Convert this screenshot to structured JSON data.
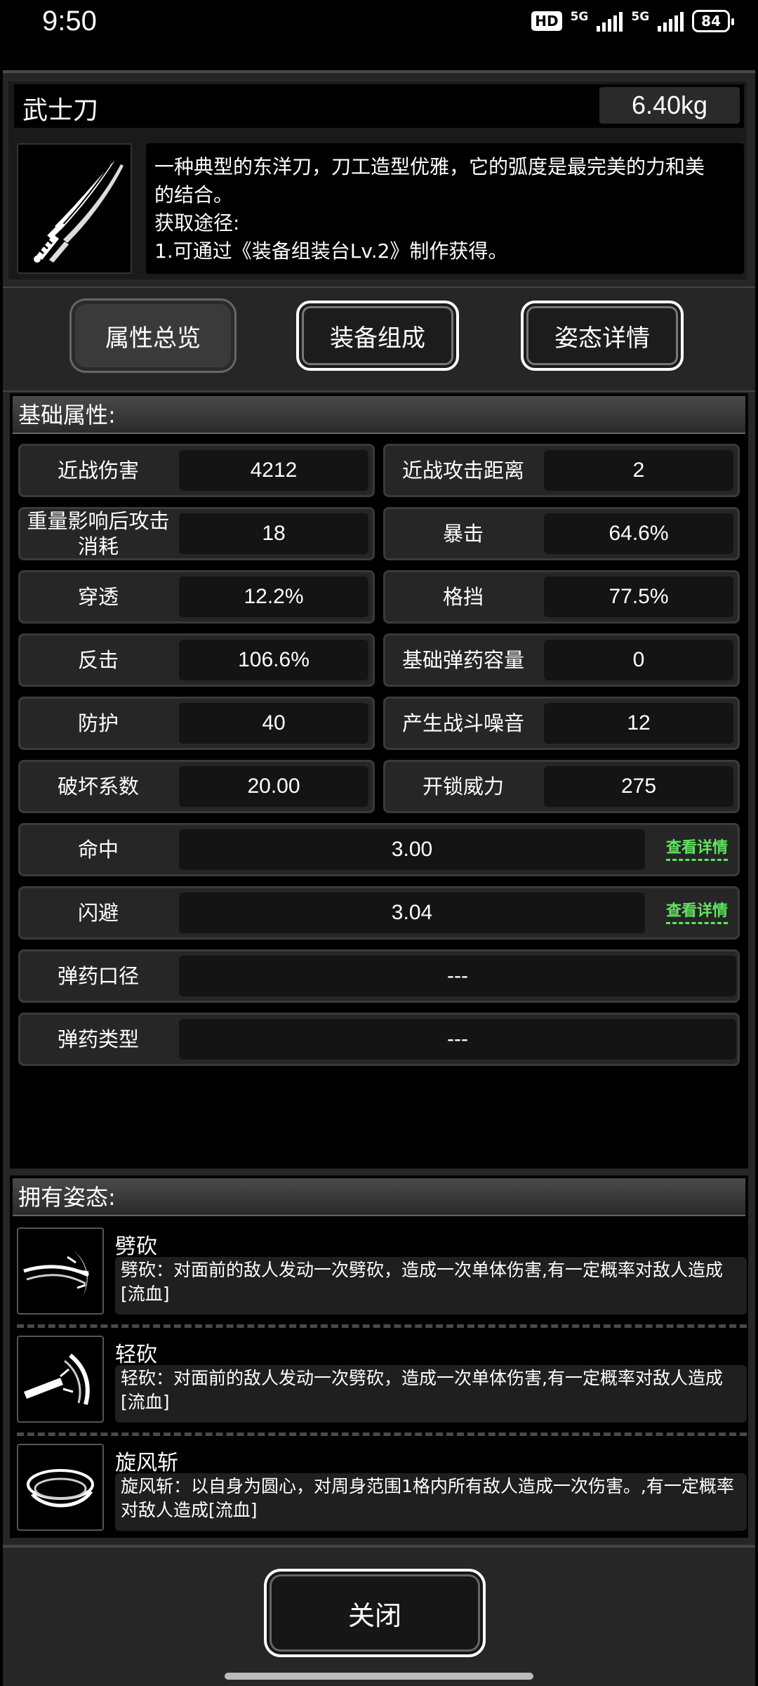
{
  "status": {
    "time": "9:50",
    "hd": "HD",
    "net1": "5G",
    "net2": "5G",
    "battery": "84"
  },
  "item": {
    "name": "武士刀",
    "weight": "6.40kg",
    "icon": "katana-icon",
    "description_lines": [
      "一种典型的东洋刀，刀工造型优雅，它的弧度是最完美的力和美",
      "的结合。",
      "获取途径:",
      "1.可通过《装备组装台Lv.2》制作获得。"
    ]
  },
  "tabs": [
    {
      "label": "属性总览",
      "active": true
    },
    {
      "label": "装备组成",
      "active": false
    },
    {
      "label": "姿态详情",
      "active": false
    }
  ],
  "base_attrs": {
    "title": "基础属性:",
    "pairs": [
      {
        "l_label": "近战伤害",
        "l_value": "4212",
        "r_label": "近战攻击距离",
        "r_value": "2"
      },
      {
        "l_label": "重量影响后攻击消耗",
        "l_value": "18",
        "r_label": "暴击",
        "r_value": "64.6%"
      },
      {
        "l_label": "穿透",
        "l_value": "12.2%",
        "r_label": "格挡",
        "r_value": "77.5%"
      },
      {
        "l_label": "反击",
        "l_value": "106.6%",
        "r_label": "基础弹药容量",
        "r_value": "0"
      },
      {
        "l_label": "防护",
        "l_value": "40",
        "r_label": "产生战斗噪音",
        "r_value": "12"
      },
      {
        "l_label": "破坏系数",
        "l_value": "20.00",
        "r_label": "开锁威力",
        "r_value": "275"
      }
    ],
    "wide": [
      {
        "label": "命中",
        "value": "3.00",
        "link": "查看详情"
      },
      {
        "label": "闪避",
        "value": "3.04",
        "link": "查看详情"
      },
      {
        "label": "弹药口径",
        "value": "---"
      },
      {
        "label": "弹药类型",
        "value": "---"
      }
    ]
  },
  "stances": {
    "title": "拥有姿态:",
    "items": [
      {
        "name": "劈砍",
        "desc": "劈砍：对面前的敌人发动一次劈砍，造成一次单体伤害,有一定概率对敌人造成[流血]",
        "icon": "slash-icon"
      },
      {
        "name": "轻砍",
        "desc": "轻砍：对面前的敌人发动一次劈砍，造成一次单体伤害,有一定概率对敌人造成[流血]",
        "icon": "light-slash-icon"
      },
      {
        "name": "旋风斩",
        "desc": "旋风斩：以自身为圆心，对周身范围1格内所有敌人造成一次伤害。,有一定概率对敌人造成[流血]",
        "icon": "whirlwind-icon"
      }
    ]
  },
  "close_label": "关闭"
}
